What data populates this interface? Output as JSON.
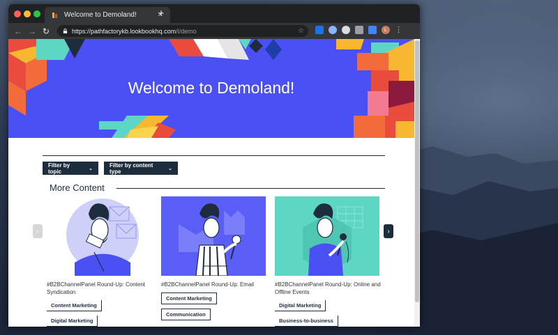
{
  "browser": {
    "tab_title": "Welcome to Demoland!",
    "url_host": "https://pathfactorykb.lookbookhq.com",
    "url_path": "/l/demo",
    "profile_initial": "L"
  },
  "hero": {
    "title": "Welcome to Demoland!"
  },
  "filters": {
    "topic": "Filter by topic",
    "content_type": "Filter by content type"
  },
  "section": {
    "title": "More Content"
  },
  "cards": [
    {
      "title": "#B2BChannelPanel Round-Up: Content Syndication",
      "tags": [
        "Content Marketing",
        "Digital Marketing"
      ]
    },
    {
      "title": "#B2BChannelPanel Round-Up: Email",
      "tags": [
        "Content Marketing",
        "Communication"
      ]
    },
    {
      "title": "#B2BChannelPanel Round-Up: Online and Offline Events",
      "tags": [
        "Digital Marketing",
        "Business-to-business"
      ]
    }
  ],
  "colors": {
    "hero_bg": "#4b50f5",
    "dark_navy": "#1d2d3e",
    "card2_bg": "#5a5ef7",
    "card3_bg": "#5ed6c4"
  },
  "icons": {
    "nav_back": "←",
    "nav_forward": "→",
    "reload": "↻",
    "star": "☆",
    "chevron": "⌄",
    "prev": "‹",
    "next": "›",
    "close": "✕",
    "new_tab": "+",
    "menu": "⋮"
  }
}
